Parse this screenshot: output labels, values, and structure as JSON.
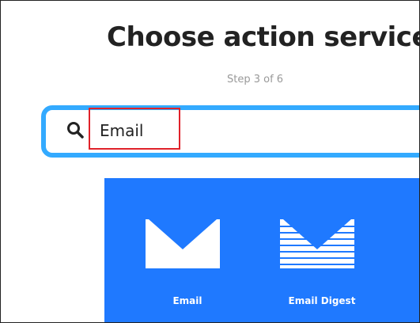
{
  "header": {
    "title": "Choose action service",
    "step": "Step 3 of 6"
  },
  "search": {
    "value": "Email",
    "icon": "search-icon"
  },
  "colors": {
    "accent": "#33aaff",
    "panel": "#1f79ff",
    "highlight": "#e0222a"
  },
  "services": [
    {
      "label": "Email",
      "icon": "envelope-icon"
    },
    {
      "label": "Email Digest",
      "icon": "envelope-lines-icon"
    }
  ]
}
